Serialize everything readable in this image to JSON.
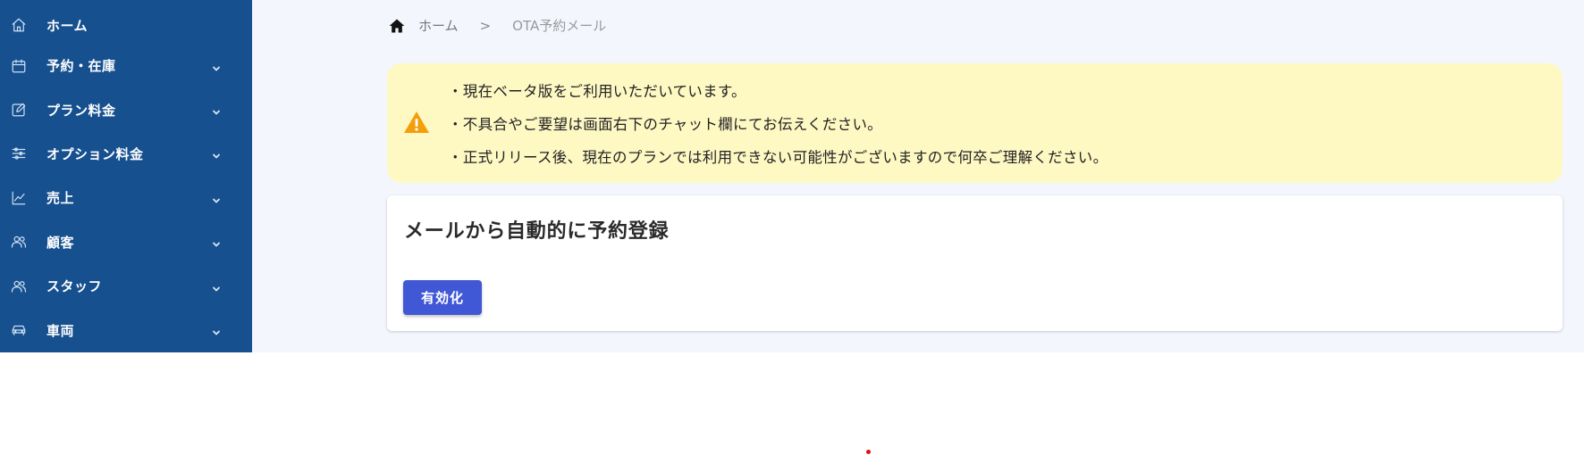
{
  "sidebar": {
    "items": [
      {
        "label": "ホーム",
        "icon": "home-outline-icon",
        "has_chevron": false
      },
      {
        "label": "予約・在庫",
        "icon": "calendar-icon",
        "has_chevron": true
      },
      {
        "label": "プラン料金",
        "icon": "edit-icon",
        "has_chevron": true
      },
      {
        "label": "オプション料金",
        "icon": "sliders-icon",
        "has_chevron": true
      },
      {
        "label": "売上",
        "icon": "chart-line-icon",
        "has_chevron": true
      },
      {
        "label": "顧客",
        "icon": "users-icon",
        "has_chevron": true
      },
      {
        "label": "スタッフ",
        "icon": "users-icon",
        "has_chevron": true
      },
      {
        "label": "車両",
        "icon": "car-icon",
        "has_chevron": true
      }
    ]
  },
  "breadcrumb": {
    "home": "ホーム",
    "separator": ">",
    "current": "OTA予約メール"
  },
  "alert": {
    "icon": "warning-icon",
    "lines": [
      "・現在ベータ版をご利用いただいています。",
      "・不具合やご要望は画面右下のチャット欄にてお伝えください。",
      "・正式リリース後、現在のプランでは利用できない可能性がございますので何卒ご理解ください。"
    ]
  },
  "card": {
    "title": "メールから自動的に予約登録",
    "button_label": "有効化"
  },
  "colors": {
    "sidebar_bg": "#16508f",
    "main_bg": "#f3f6fc",
    "alert_bg": "#fef8c3",
    "warning": "#f59e0b",
    "primary": "#4158d6"
  }
}
